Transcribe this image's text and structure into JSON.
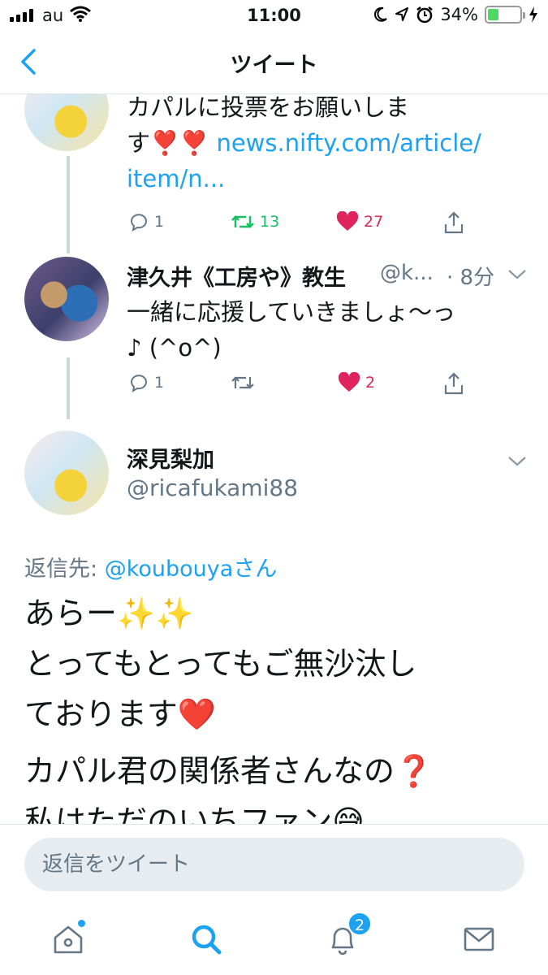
{
  "status_bar": {
    "carrier": "au",
    "time": "11:00",
    "battery": "34%",
    "battery_level": 0.34
  },
  "nav": {
    "title": "ツイート",
    "back_icon": "chevron-left-icon"
  },
  "thread": {
    "tweet1": {
      "text_line1": "カパルに投票をお願いしま",
      "text_line2_prefix": "す",
      "emoji": "❣️❣️",
      "link_line1": "news.nifty.com/article/",
      "link_line2": "item/n...",
      "reply_count": "1",
      "retweet_count": "13",
      "like_count": "27"
    },
    "tweet2": {
      "name": "津久井《工房や》教生",
      "handle": "@k...",
      "time": "· 8分",
      "text_line1": "一緒に応援していきましょ〜っ",
      "text_line2": "♪ (^o^)",
      "reply_count": "1",
      "like_count": "2"
    }
  },
  "focused_tweet": {
    "name": "深見梨加",
    "handle": "@ricafukami88",
    "reply_to_label": "返信先:",
    "reply_to_handle": "@koubouyaさん",
    "line1": "あらー✨✨",
    "line2": "とってもとってもご無沙汰し",
    "line3": "ております❤️",
    "line4": "カパル君の関係者さんなの❓",
    "line5": "私はただのいちファン😅"
  },
  "composer": {
    "placeholder": "返信をツイート"
  },
  "tab_bar": {
    "items": [
      {
        "icon": "home-icon",
        "has_dot": true
      },
      {
        "icon": "search-icon",
        "active": true
      },
      {
        "icon": "bell-icon",
        "badge": "2"
      },
      {
        "icon": "mail-icon"
      }
    ],
    "notification_badge": "2"
  },
  "colors": {
    "accent": "#1da1f2",
    "retweet_active": "#17bf63",
    "like_active": "#e0245e",
    "secondary_text": "#657786"
  }
}
